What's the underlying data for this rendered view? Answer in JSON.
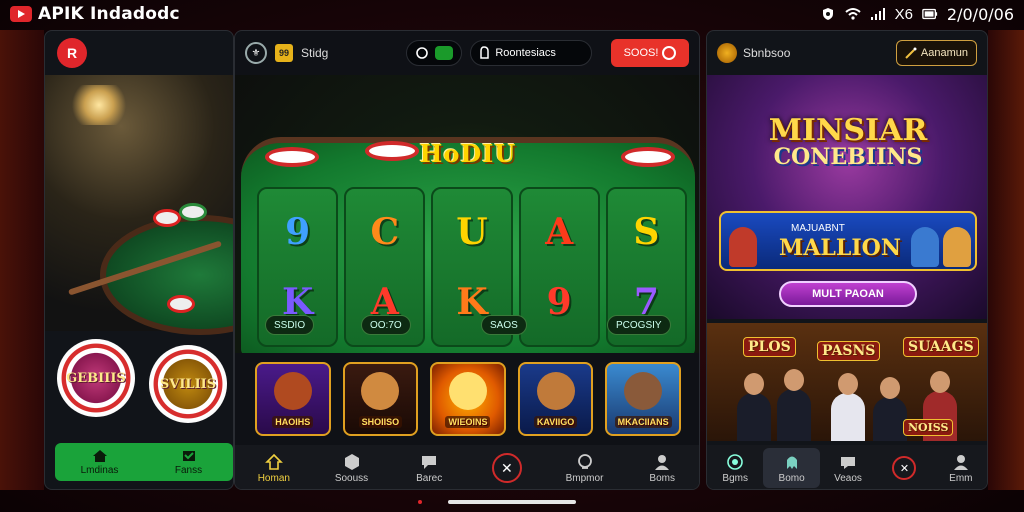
{
  "status_bar": {
    "app_title": "APIK Indadodc",
    "time": "2/0/0/06",
    "indicators": [
      "shield-icon",
      "wifi-icon",
      "signal-icon",
      "x-icon",
      "battery-icon"
    ],
    "extra": "X6"
  },
  "left_panel": {
    "brand_icon": "R",
    "chips": [
      "GEBIIIS",
      "SVILIIS"
    ],
    "nav": [
      {
        "label": "Lmdinas",
        "icon": "home-icon"
      },
      {
        "label": "Fanss",
        "icon": "cards-icon"
      }
    ]
  },
  "middle_panel": {
    "top": {
      "logo_text": "⚜",
      "label": "Stidg",
      "badge": "99",
      "pill_icon": "refresh-icon",
      "search_text": "Roontesiacs",
      "red_button": "SOOS!"
    },
    "stage_title": "HoDIU",
    "reels": [
      [
        "9",
        "K"
      ],
      [
        "C",
        "A"
      ],
      [
        "U",
        "K"
      ],
      [
        "A",
        "9"
      ],
      [
        "S",
        "7"
      ]
    ],
    "reel_colors": [
      [
        "#3fa0ff",
        "#7a5aff"
      ],
      [
        "#ff8a1a",
        "#ff3a2a"
      ],
      [
        "#ffd400",
        "#ff7a1a"
      ],
      [
        "#ff3a1a",
        "#ff3a2a"
      ],
      [
        "#ffd400",
        "#9a5aff"
      ]
    ],
    "reel_labels": [
      "SSDIO",
      "OO:7O",
      "SAOS",
      "PCOGSIY"
    ],
    "games": [
      {
        "title": "HAOIHS",
        "name": "game-tile-1"
      },
      {
        "title": "SHOIISO",
        "name": "game-tile-2"
      },
      {
        "title": "WIEOINS",
        "name": "game-tile-3"
      },
      {
        "title": "KAVIIGO",
        "name": "game-tile-4"
      },
      {
        "title": "MKACIIANS",
        "name": "game-tile-5"
      }
    ],
    "nav": [
      {
        "label": "Homan",
        "icon": "home-icon",
        "active": true
      },
      {
        "label": "Soouss",
        "icon": "box-icon",
        "active": false
      },
      {
        "label": "Barec",
        "icon": "chat-icon",
        "active": false
      },
      {
        "label": "",
        "icon": "close-icon",
        "active": false
      },
      {
        "label": "Bmpmor",
        "icon": "support-icon",
        "active": false
      },
      {
        "label": "Boms",
        "icon": "user-icon",
        "active": false
      }
    ]
  },
  "right_panel": {
    "top": {
      "label": "Sbnbsoo",
      "button": "Aanamun"
    },
    "banner": {
      "line1": "MINSIAR",
      "line2": "CONEBIINS",
      "card_small": "MAJUABNT",
      "card_big": "MALLION",
      "cta": "MULT PAOAN"
    },
    "promo": {
      "tag1": "PLOS",
      "tag2": "PASNS",
      "tag3": "SUAAGS",
      "tag4": "NOISS"
    },
    "nav": [
      {
        "label": "Bgms",
        "icon": "target-icon",
        "selected": false
      },
      {
        "label": "Bomo",
        "icon": "alien-icon",
        "selected": true
      },
      {
        "label": "Veaos",
        "icon": "ghost-icon",
        "selected": false
      },
      {
        "label": "",
        "icon": "close-icon",
        "selected": false
      },
      {
        "label": "Emm",
        "icon": "person-icon",
        "selected": false
      }
    ]
  },
  "colors": {
    "accent_red": "#e0262b",
    "accent_green": "#1aa33a",
    "gold": "#ffd400",
    "panel_bg": "#111419"
  }
}
